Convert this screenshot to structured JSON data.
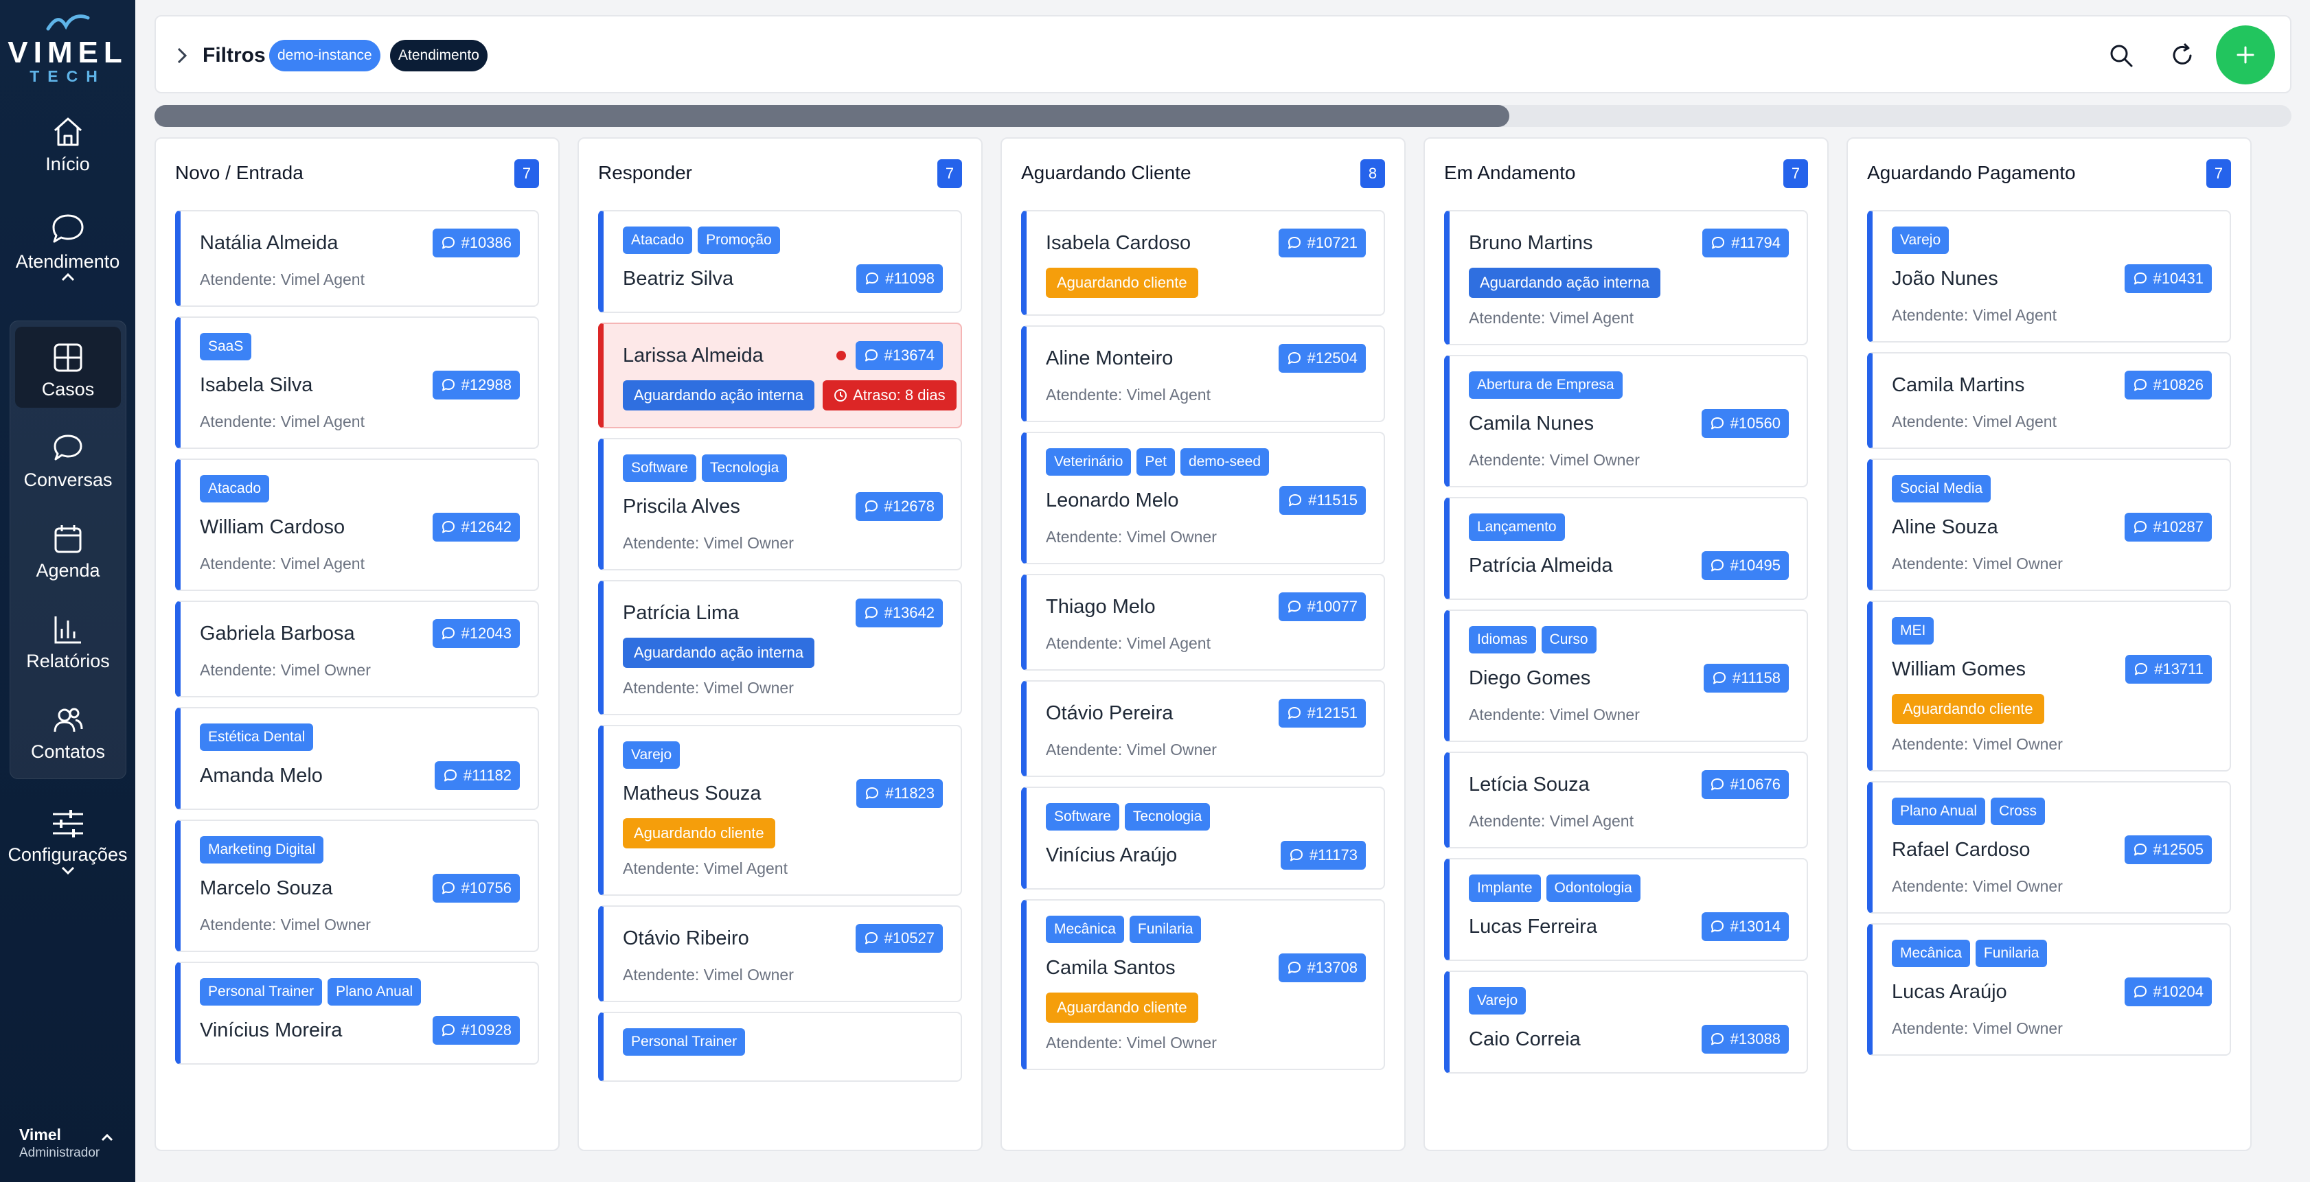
{
  "brand": {
    "name": "VIMEL",
    "sub": "TECH"
  },
  "nav": {
    "inicio": "Início",
    "atendimento": "Atendimento",
    "casos": "Casos",
    "conversas": "Conversas",
    "agenda": "Agenda",
    "relatorios": "Relatórios",
    "contatos": "Contatos",
    "configuracoes": "Configurações"
  },
  "user": {
    "name": "Vimel",
    "role": "Administrador"
  },
  "filters": {
    "title": "Filtros",
    "chips": [
      "demo-instance",
      "Atendimento"
    ]
  },
  "scroll": {
    "visible_fraction": 0.634
  },
  "colors": {
    "primary": "#2563eb",
    "chip": "#3b82f6",
    "success": "#22c55e",
    "warning": "#f59e0b",
    "danger": "#dc2626",
    "sidebar": "#0f2440"
  },
  "columns": [
    {
      "title": "Novo / Entrada",
      "count": "7",
      "cards": [
        {
          "tags": [],
          "name": "Natália Almeida",
          "ticket": "#10386",
          "statuses": [],
          "agent": "Atendente: Vimel Agent"
        },
        {
          "tags": [
            "SaaS"
          ],
          "name": "Isabela Silva",
          "ticket": "#12988",
          "statuses": [],
          "agent": "Atendente: Vimel Agent"
        },
        {
          "tags": [
            "Atacado"
          ],
          "name": "William Cardoso",
          "ticket": "#12642",
          "statuses": [],
          "agent": "Atendente: Vimel Agent"
        },
        {
          "tags": [],
          "name": "Gabriela Barbosa",
          "ticket": "#12043",
          "statuses": [],
          "agent": "Atendente: Vimel Owner"
        },
        {
          "tags": [
            "Estética Dental"
          ],
          "name": "Amanda Melo",
          "ticket": "#11182",
          "statuses": [],
          "agent": ""
        },
        {
          "tags": [
            "Marketing Digital"
          ],
          "name": "Marcelo Souza",
          "ticket": "#10756",
          "statuses": [],
          "agent": "Atendente: Vimel Owner"
        },
        {
          "tags": [
            "Personal Trainer",
            "Plano Anual"
          ],
          "name": "Vinícius Moreira",
          "ticket": "#10928",
          "statuses": [],
          "agent": ""
        }
      ]
    },
    {
      "title": "Responder",
      "count": "7",
      "cards": [
        {
          "tags": [
            "Atacado",
            "Promoção"
          ],
          "name": "Beatriz Silva",
          "ticket": "#11098",
          "statuses": [],
          "agent": ""
        },
        {
          "tags": [],
          "name": "Larissa Almeida",
          "ticket": "#13674",
          "alert": true,
          "statuses": [
            {
              "text": "Aguardando ação interna",
              "kind": "info"
            },
            {
              "text": "Atraso: 8 dias",
              "kind": "danger"
            }
          ],
          "agent": ""
        },
        {
          "tags": [
            "Software",
            "Tecnologia"
          ],
          "name": "Priscila Alves",
          "ticket": "#12678",
          "statuses": [],
          "agent": "Atendente: Vimel Owner"
        },
        {
          "tags": [],
          "name": "Patrícia Lima",
          "ticket": "#13642",
          "statuses": [
            {
              "text": "Aguardando ação interna",
              "kind": "info"
            }
          ],
          "agent": "Atendente: Vimel Owner"
        },
        {
          "tags": [
            "Varejo"
          ],
          "name": "Matheus Souza",
          "ticket": "#11823",
          "statuses": [
            {
              "text": "Aguardando cliente",
              "kind": "warn"
            }
          ],
          "agent": "Atendente: Vimel Agent"
        },
        {
          "tags": [],
          "name": "Otávio Ribeiro",
          "ticket": "#10527",
          "statuses": [],
          "agent": "Atendente: Vimel Owner"
        },
        {
          "tags": [
            "Personal Trainer"
          ],
          "name": "",
          "ticket": "",
          "statuses": [],
          "agent": ""
        }
      ]
    },
    {
      "title": "Aguardando Cliente",
      "count": "8",
      "cards": [
        {
          "tags": [],
          "name": "Isabela Cardoso",
          "ticket": "#10721",
          "statuses": [
            {
              "text": "Aguardando cliente",
              "kind": "warn"
            }
          ],
          "agent": ""
        },
        {
          "tags": [],
          "name": "Aline Monteiro",
          "ticket": "#12504",
          "statuses": [],
          "agent": "Atendente: Vimel Agent"
        },
        {
          "tags": [
            "Veterinário",
            "Pet",
            "demo-seed"
          ],
          "name": "Leonardo Melo",
          "ticket": "#11515",
          "statuses": [],
          "agent": "Atendente: Vimel Owner"
        },
        {
          "tags": [],
          "name": "Thiago Melo",
          "ticket": "#10077",
          "statuses": [],
          "agent": "Atendente: Vimel Agent"
        },
        {
          "tags": [],
          "name": "Otávio Pereira",
          "ticket": "#12151",
          "statuses": [],
          "agent": "Atendente: Vimel Owner"
        },
        {
          "tags": [
            "Software",
            "Tecnologia"
          ],
          "name": "Vinícius Araújo",
          "ticket": "#11173",
          "statuses": [],
          "agent": ""
        },
        {
          "tags": [
            "Mecânica",
            "Funilaria"
          ],
          "name": "Camila Santos",
          "ticket": "#13708",
          "statuses": [
            {
              "text": "Aguardando cliente",
              "kind": "warn"
            }
          ],
          "agent": "Atendente: Vimel Owner"
        }
      ]
    },
    {
      "title": "Em Andamento",
      "count": "7",
      "cards": [
        {
          "tags": [],
          "name": "Bruno Martins",
          "ticket": "#11794",
          "statuses": [
            {
              "text": "Aguardando ação interna",
              "kind": "info"
            }
          ],
          "agent": "Atendente: Vimel Agent"
        },
        {
          "tags": [
            "Abertura de Empresa"
          ],
          "name": "Camila Nunes",
          "ticket": "#10560",
          "statuses": [],
          "agent": "Atendente: Vimel Owner"
        },
        {
          "tags": [
            "Lançamento"
          ],
          "name": "Patrícia Almeida",
          "ticket": "#10495",
          "statuses": [],
          "agent": ""
        },
        {
          "tags": [
            "Idiomas",
            "Curso"
          ],
          "name": "Diego Gomes",
          "ticket": "#11158",
          "statuses": [],
          "agent": "Atendente: Vimel Owner"
        },
        {
          "tags": [],
          "name": "Letícia Souza",
          "ticket": "#10676",
          "statuses": [],
          "agent": "Atendente: Vimel Agent"
        },
        {
          "tags": [
            "Implante",
            "Odontologia"
          ],
          "name": "Lucas Ferreira",
          "ticket": "#13014",
          "statuses": [],
          "agent": ""
        },
        {
          "tags": [
            "Varejo"
          ],
          "name": "Caio Correia",
          "ticket": "#13088",
          "statuses": [],
          "agent": ""
        }
      ]
    },
    {
      "title": "Aguardando Pagamento",
      "count": "7",
      "cards": [
        {
          "tags": [
            "Varejo"
          ],
          "name": "João Nunes",
          "ticket": "#10431",
          "statuses": [],
          "agent": "Atendente: Vimel Agent"
        },
        {
          "tags": [],
          "name": "Camila Martins",
          "ticket": "#10826",
          "statuses": [],
          "agent": "Atendente: Vimel Agent"
        },
        {
          "tags": [
            "Social Media"
          ],
          "name": "Aline Souza",
          "ticket": "#10287",
          "statuses": [],
          "agent": "Atendente: Vimel Owner"
        },
        {
          "tags": [
            "MEI"
          ],
          "name": "William Gomes",
          "ticket": "#13711",
          "statuses": [
            {
              "text": "Aguardando cliente",
              "kind": "warn"
            }
          ],
          "agent": "Atendente: Vimel Owner"
        },
        {
          "tags": [
            "Plano Anual",
            "Cross"
          ],
          "name": "Rafael Cardoso",
          "ticket": "#12505",
          "statuses": [],
          "agent": "Atendente: Vimel Owner"
        },
        {
          "tags": [
            "Mecânica",
            "Funilaria"
          ],
          "name": "Lucas Araújo",
          "ticket": "#10204",
          "statuses": [],
          "agent": "Atendente: Vimel Owner"
        }
      ]
    }
  ]
}
